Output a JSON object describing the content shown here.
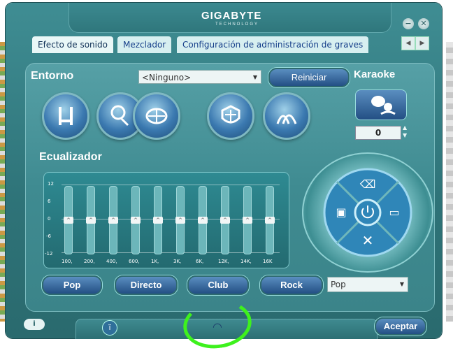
{
  "app": {
    "brand": "GIGABYTE",
    "brand_sub": "TECHNOLOGY"
  },
  "window_buttons": {
    "minimize": "−",
    "close": "✕"
  },
  "tabs": [
    {
      "label": "Efecto de sonido",
      "active": true
    },
    {
      "label": "Mezclador",
      "active": false
    },
    {
      "label": "Configuración de administración de graves",
      "active": false
    }
  ],
  "environment": {
    "label": "Entorno",
    "select_value": "<Ninguno>",
    "reset_label": "Reiniciar",
    "presets": [
      {
        "icon": "padded-cell-icon"
      },
      {
        "icon": "bathroom-icon"
      },
      {
        "icon": "stadium-icon"
      },
      {
        "icon": "colosseum-icon"
      },
      {
        "icon": "concert-hall-icon"
      }
    ]
  },
  "karaoke": {
    "label": "Karaoke",
    "value": "0"
  },
  "equalizer": {
    "label": "Ecualizador",
    "db_scale": [
      "12",
      "6",
      "0",
      "-6",
      "-12"
    ],
    "bands": [
      {
        "freq": "100,",
        "gain_db": 0
      },
      {
        "freq": "200,",
        "gain_db": 0
      },
      {
        "freq": "400,",
        "gain_db": 0
      },
      {
        "freq": "600,",
        "gain_db": 0
      },
      {
        "freq": "1K,",
        "gain_db": 0
      },
      {
        "freq": "3K,",
        "gain_db": 0
      },
      {
        "freq": "6K,",
        "gain_db": 0
      },
      {
        "freq": "12K,",
        "gain_db": 0
      },
      {
        "freq": "14K,",
        "gain_db": 0
      },
      {
        "freq": "16K",
        "gain_db": 0
      }
    ],
    "presets": [
      "Pop",
      "Directo",
      "Club",
      "Rock"
    ],
    "preset_select": "Pop"
  },
  "footer": {
    "accept_label": "Aceptar"
  },
  "colors": {
    "highlight_circle": "#3ef11d",
    "accent_blue": "#234f84"
  }
}
